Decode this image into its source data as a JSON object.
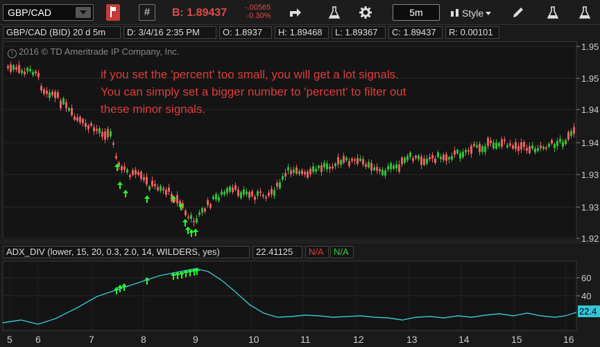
{
  "toolbar": {
    "symbol": "GBP/CAD",
    "hash_label": "#",
    "bid": "B: 1.89437",
    "change_abs": "-.00565",
    "change_pct": "-0.30%",
    "timeframe": "5m",
    "style_label": "Style",
    "icons": [
      "flag-icon",
      "share-icon",
      "flask-icon",
      "gear-icon",
      "pencil-icon",
      "flask-icon",
      "flask-icon"
    ]
  },
  "info": {
    "title": "GBP/CAD (BID) 20 d 5m",
    "date": "D: 3/4/16 2:35 PM",
    "open": "O: 1.8937",
    "high": "H: 1.89468",
    "low": "L: 1.89367",
    "close": "C: 1.89437",
    "range": "R: 0.00101"
  },
  "upper": {
    "copyright": "2016 © TD Ameritrade IP Company, Inc.",
    "annotation": [
      "if you set the 'percent' too small, you will get a lot signals.",
      "You can simply set a bigger number to 'percent' to filter out",
      "these minor signals."
    ],
    "price_ticks": [
      "1.95",
      "1.95",
      "1.94",
      "1.94",
      "1.93",
      "1.93",
      "1.92"
    ]
  },
  "lower": {
    "study": "ADX_DIV (lower, 15, 20, 0.3, 2.0, 14, WILDERS, yes)",
    "value": "22.41125",
    "na1": "N/A",
    "na2": "N/A",
    "ticks": [
      "60",
      "40"
    ],
    "current_label": "22.4"
  },
  "xaxis": [
    "5",
    "6",
    "7",
    "8",
    "9",
    "10",
    "11",
    "12",
    "13",
    "14",
    "15",
    "16"
  ],
  "colors": {
    "up": "#2fbf3a",
    "down": "#e86060",
    "arrow": "#22ff22",
    "adx": "#35c6d0",
    "annotation": "#e03c3c"
  }
}
